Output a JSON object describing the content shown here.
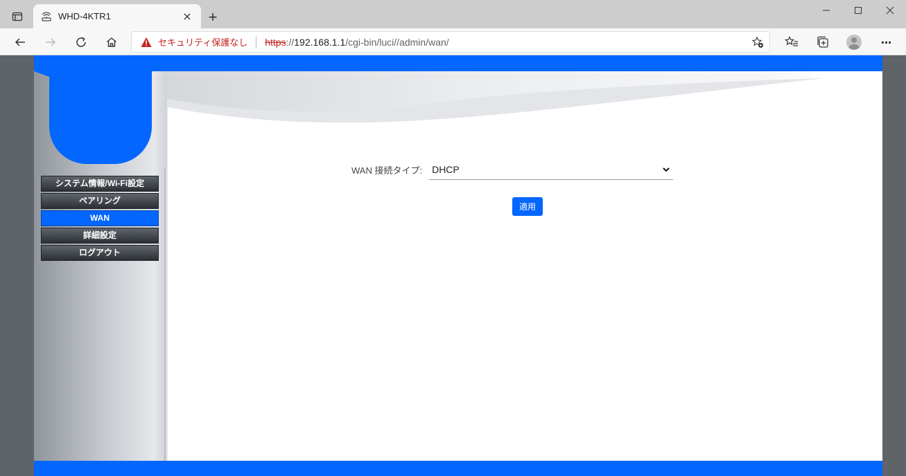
{
  "browser": {
    "tab": {
      "title": "WHD-4KTR1",
      "close": "×"
    },
    "new_tab": "+",
    "security_label": "セキュリティ保護なし",
    "url": {
      "scheme": "https",
      "rest_prefix": "://",
      "host": "192.168.1.1",
      "path": "/cgi-bin/luci//admin/wan/"
    },
    "more": "···"
  },
  "sidebar": {
    "items": [
      {
        "label": "システム情報/Wi-Fi設定",
        "active": false
      },
      {
        "label": "ペアリング",
        "active": false
      },
      {
        "label": "WAN",
        "active": true
      },
      {
        "label": "詳細設定",
        "active": false
      },
      {
        "label": "ログアウト",
        "active": false
      }
    ]
  },
  "form": {
    "wan_type_label": "WAN 接続タイプ:",
    "wan_type_value": "DHCP",
    "apply_label": "適用"
  },
  "colors": {
    "brand_blue": "#0266ff",
    "warning_red": "#c5221f"
  }
}
